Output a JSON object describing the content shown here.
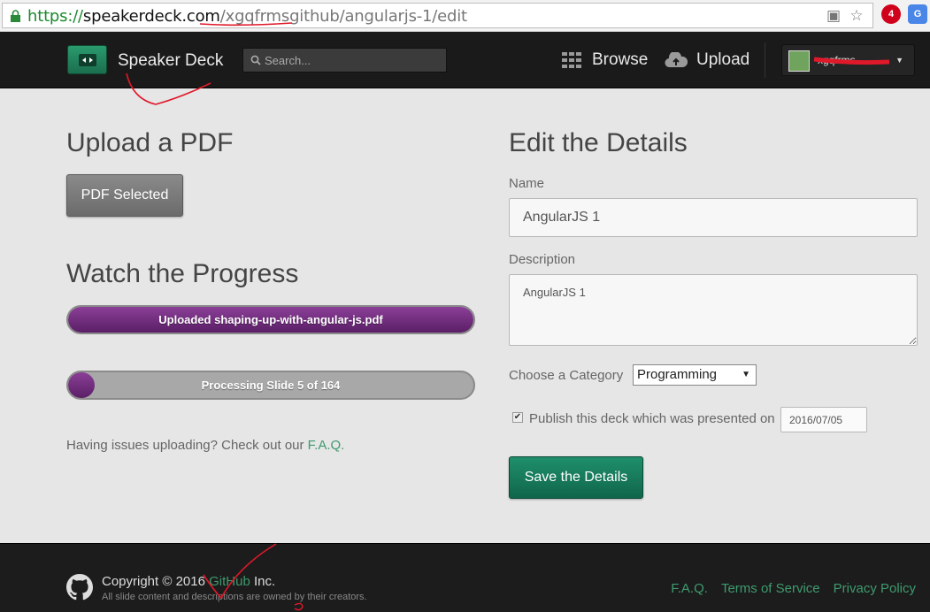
{
  "browser": {
    "url_scheme": "https://",
    "url_host": "speakerdeck.com",
    "url_path": "/xgqfrmsgithub/angularjs-1/edit",
    "icons": [
      "lock-icon",
      "translate-icon",
      "star-icon",
      "opera-extension-icon",
      "google-translate-icon"
    ],
    "opera_badge": "4",
    "gt_label": "G"
  },
  "header": {
    "brand": "Speaker Deck",
    "search_placeholder": "Search...",
    "nav_browse": "Browse",
    "nav_upload": "Upload",
    "user_name": "xgqfrms"
  },
  "upload": {
    "title": "Upload a PDF",
    "button_label": "PDF Selected"
  },
  "progress": {
    "title": "Watch the Progress",
    "upload_bar_text": "Uploaded shaping-up-with-angular-js.pdf",
    "upload_fraction": 1.0,
    "processing_bar_text": "Processing Slide 5 of 164",
    "processing_fraction": 0.03
  },
  "help": {
    "text": "Having issues uploading? Check out our ",
    "link": "F.A.Q."
  },
  "details": {
    "title": "Edit the Details",
    "name_label": "Name",
    "name_value": "AngularJS 1",
    "description_label": "Description",
    "description_value": "AngularJS 1",
    "category_label": "Choose a Category",
    "category_value": "Programming",
    "publish_label": "Publish this deck which was presented on",
    "publish_checked": true,
    "date_value": "2016/07/05",
    "save_label": "Save the Details"
  },
  "footer": {
    "copyright_prefix": "Copyright © 2016 ",
    "copyright_link": "GitHub",
    "copyright_suffix": " Inc.",
    "subtext": "All slide content and descriptions are owned by their creators.",
    "links": [
      "F.A.Q.",
      "Terms of Service",
      "Privacy Policy"
    ]
  },
  "colors": {
    "accent_green": "#3e9b6e",
    "progress_purple": "#6b2a78",
    "header_bg": "#1a1a1a"
  }
}
